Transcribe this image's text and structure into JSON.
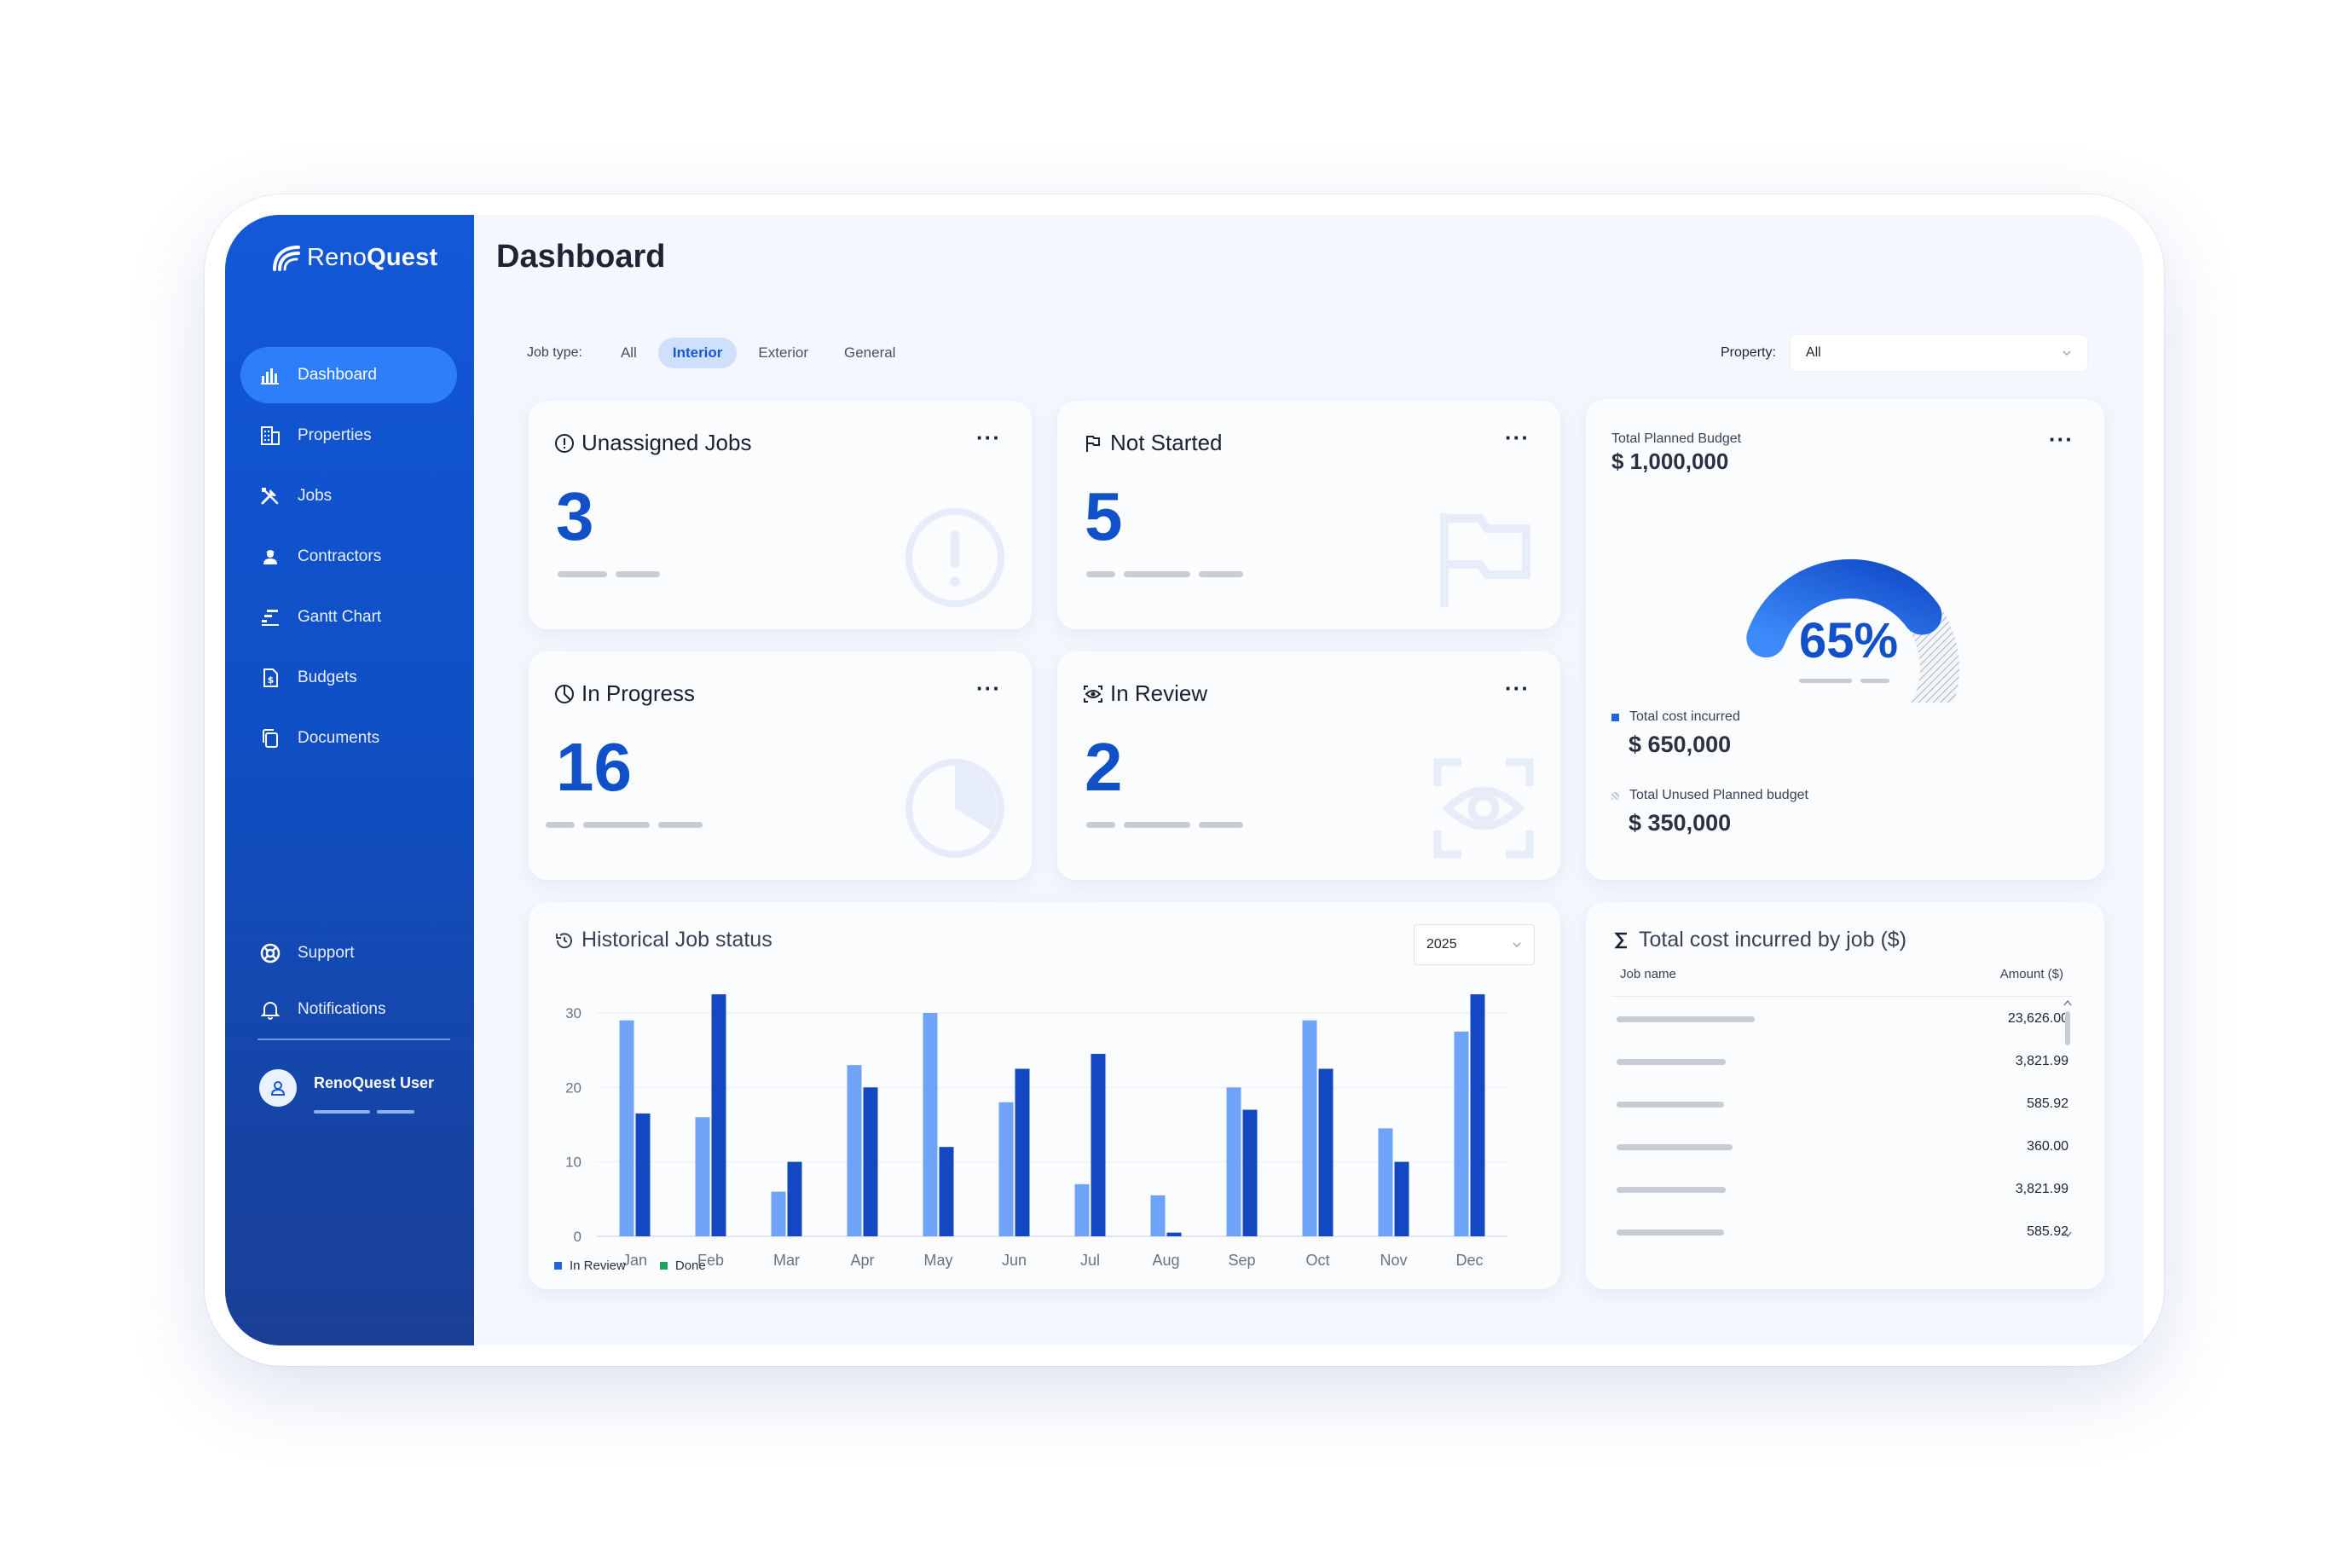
{
  "app": {
    "brand_prefix": "Reno",
    "brand_suffix": "Quest"
  },
  "page": {
    "title": "Dashboard"
  },
  "sidebar": {
    "items": [
      {
        "label": "Dashboard",
        "icon": "bar-chart-icon",
        "active": true
      },
      {
        "label": "Properties",
        "icon": "building-icon"
      },
      {
        "label": "Jobs",
        "icon": "tools-icon"
      },
      {
        "label": "Contractors",
        "icon": "contractor-icon"
      },
      {
        "label": "Gantt Chart",
        "icon": "gantt-icon"
      },
      {
        "label": "Budgets",
        "icon": "budget-doc-icon"
      },
      {
        "label": "Documents",
        "icon": "documents-icon"
      }
    ],
    "bottom": [
      {
        "label": "Support",
        "icon": "lifebuoy-icon"
      },
      {
        "label": "Notifications",
        "icon": "bell-icon"
      }
    ],
    "user": {
      "name": "RenoQuest User"
    }
  },
  "filters": {
    "job_type_label": "Job type:",
    "chips": [
      "All",
      "Interior",
      "Exterior",
      "General"
    ],
    "active_chip": "Interior",
    "property_label": "Property:",
    "property_value": "All"
  },
  "stats": {
    "unassigned": {
      "title": "Unassigned Jobs",
      "value": "3"
    },
    "not_started": {
      "title": "Not Started",
      "value": "5"
    },
    "in_progress": {
      "title": "In Progress",
      "value": "16"
    },
    "in_review": {
      "title": "In Review",
      "value": "2"
    },
    "menu_glyph": "···"
  },
  "budget": {
    "label": "Total Planned Budget",
    "value": "$ 1,000,000",
    "percent": "65%",
    "percent_value": 65,
    "incurred_label": "Total cost incurred",
    "incurred_value": "$ 650,000",
    "unused_label": "Total Unused Planned budget",
    "unused_value": "$ 350,000"
  },
  "history": {
    "title": "Historical Job status",
    "year": "2025"
  },
  "chart_data": {
    "type": "bar",
    "categories": [
      "Jan",
      "Feb",
      "Mar",
      "Apr",
      "May",
      "Jun",
      "Jul",
      "Aug",
      "Sep",
      "Oct",
      "Nov",
      "Dec"
    ],
    "series": [
      {
        "name": "In Review",
        "values": [
          29,
          16,
          6,
          23,
          30,
          18,
          7,
          5.5,
          20,
          29,
          14.5,
          27.5
        ]
      },
      {
        "name": "Done",
        "values": [
          16.5,
          32.5,
          10,
          20,
          12,
          22.5,
          24.5,
          0.5,
          17,
          22.5,
          10,
          32.5
        ]
      }
    ],
    "ylim": [
      0,
      30
    ],
    "yticks": [
      0,
      10,
      20,
      30
    ],
    "grid": true,
    "legend": "bottom-left",
    "colors": {
      "in_review": "#6fa3f7",
      "done": "#1448c2",
      "done_legend": "#20a35a"
    }
  },
  "cost_table": {
    "title": "Total cost incurred by job ($)",
    "col_name": "Job name",
    "col_amount": "Amount ($)",
    "rows": [
      "23,626.00",
      "3,821.99",
      "585.92",
      "360.00",
      "3,821.99",
      "585.92"
    ]
  }
}
